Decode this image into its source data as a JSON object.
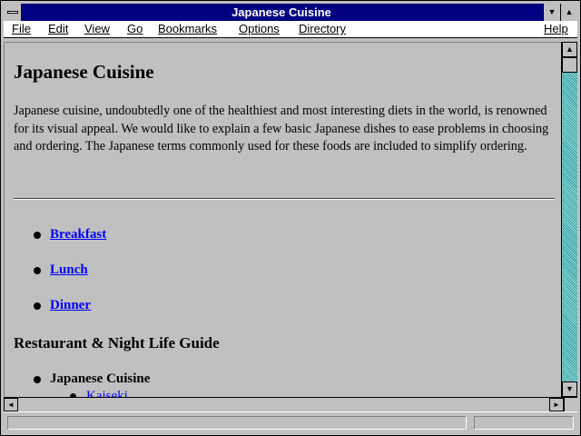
{
  "window": {
    "title": "Japanese Cuisine"
  },
  "titlebar_buttons": {
    "minimize_icon": "▼",
    "maximize_icon": "▲"
  },
  "menu": {
    "file": "File",
    "edit": "Edit",
    "view": "View",
    "go": "Go",
    "bookmarks": "Bookmarks",
    "options": "Options",
    "directory": "Directory",
    "help": "Help"
  },
  "page": {
    "heading": "Japanese Cuisine",
    "intro": "Japanese cuisine, undoubtedly one of the healthiest and most interesting diets in the world, is renowned for its visual appeal. We would like to explain a few basic Japanese dishes to ease problems in choosing and ordering. The Japanese terms commonly used for these foods are included to simplify ordering.",
    "meal_links": [
      "Breakfast",
      "Lunch",
      "Dinner"
    ],
    "guide_heading": "Restaurant & Night Life Guide",
    "guide_items": [
      "Japanese Cuisine"
    ],
    "guide_subitems": [
      "Kaiseki"
    ]
  },
  "scrollbar": {
    "up_icon": "▲",
    "down_icon": "▼",
    "left_icon": "◄",
    "right_icon": "►"
  },
  "status": {
    "text": ""
  }
}
